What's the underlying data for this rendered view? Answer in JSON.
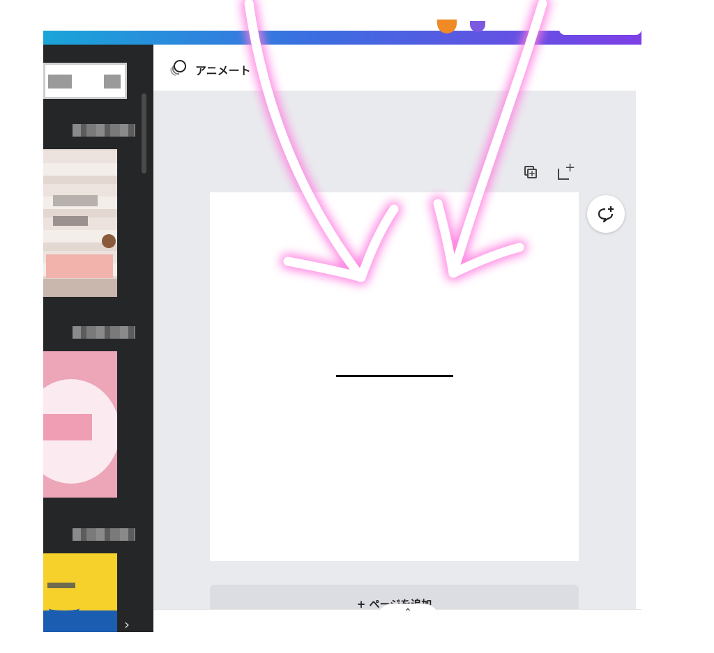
{
  "toolbar": {
    "animate_label": "アニメート"
  },
  "canvas": {
    "add_page_label": "+ ページを追加"
  },
  "sidebar": {
    "more_glyph": "›"
  },
  "ui": {
    "collapse_glyph": "‹",
    "expand_glyph": "⌃"
  },
  "colors": {
    "sidebar_bg": "#252627",
    "canvas_bg": "#e9eaee",
    "arrow_glow": "#ff7ae0"
  }
}
